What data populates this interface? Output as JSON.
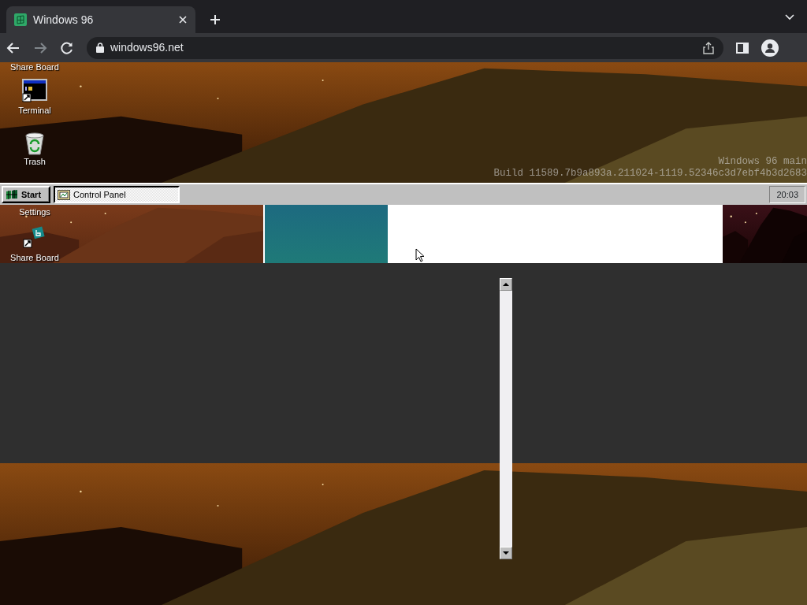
{
  "browser": {
    "tab": {
      "title": "Windows 96",
      "selected": true
    },
    "url": "windows96.net"
  },
  "desktop_top": {
    "icons": [
      {
        "label": "Share Board"
      },
      {
        "label": "Terminal",
        "kind": "terminal"
      },
      {
        "label": "Trash",
        "kind": "trash"
      }
    ],
    "watermark": [
      "Windows 96 main",
      "Build 11589.7b9a893a.211024-1119.52346c3d7ebf4b3d2683"
    ]
  },
  "taskbar": {
    "start": "Start",
    "tasks": [
      {
        "label": "Control Panel",
        "selected": true
      }
    ],
    "clock": "20:03"
  },
  "desktop_strip": {
    "icons": [
      {
        "label": "Settings"
      },
      {
        "label": "Share Board",
        "kind": "share"
      }
    ]
  }
}
